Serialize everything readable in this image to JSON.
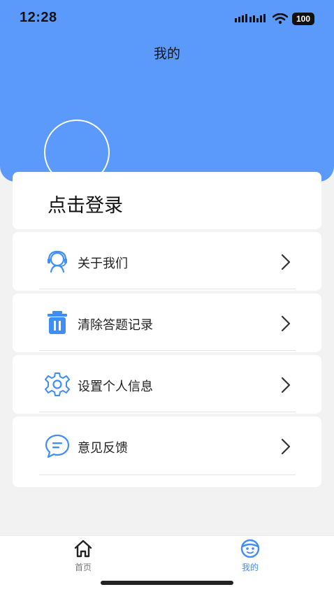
{
  "status_bar": {
    "time": "12:28",
    "battery": "100",
    "icons": [
      "signal-icon",
      "wifi-icon",
      "battery-icon"
    ]
  },
  "header": {
    "title": "我的",
    "background_color": "#5b99fb"
  },
  "login": {
    "label": "点击登录"
  },
  "menu": {
    "items": [
      {
        "label": "关于我们",
        "icon": "support-agent-icon"
      },
      {
        "label": "清除答题记录",
        "icon": "trash-icon"
      },
      {
        "label": "设置个人信息",
        "icon": "gear-icon"
      },
      {
        "label": "意见反馈",
        "icon": "chat-bubble-icon"
      }
    ],
    "accent_color": "#3f8ef7"
  },
  "tab_bar": {
    "tabs": [
      {
        "label": "首页",
        "icon": "home-icon",
        "active": false
      },
      {
        "label": "我的",
        "icon": "profile-face-icon",
        "active": true
      }
    ],
    "active_color": "#3f8ef7"
  }
}
